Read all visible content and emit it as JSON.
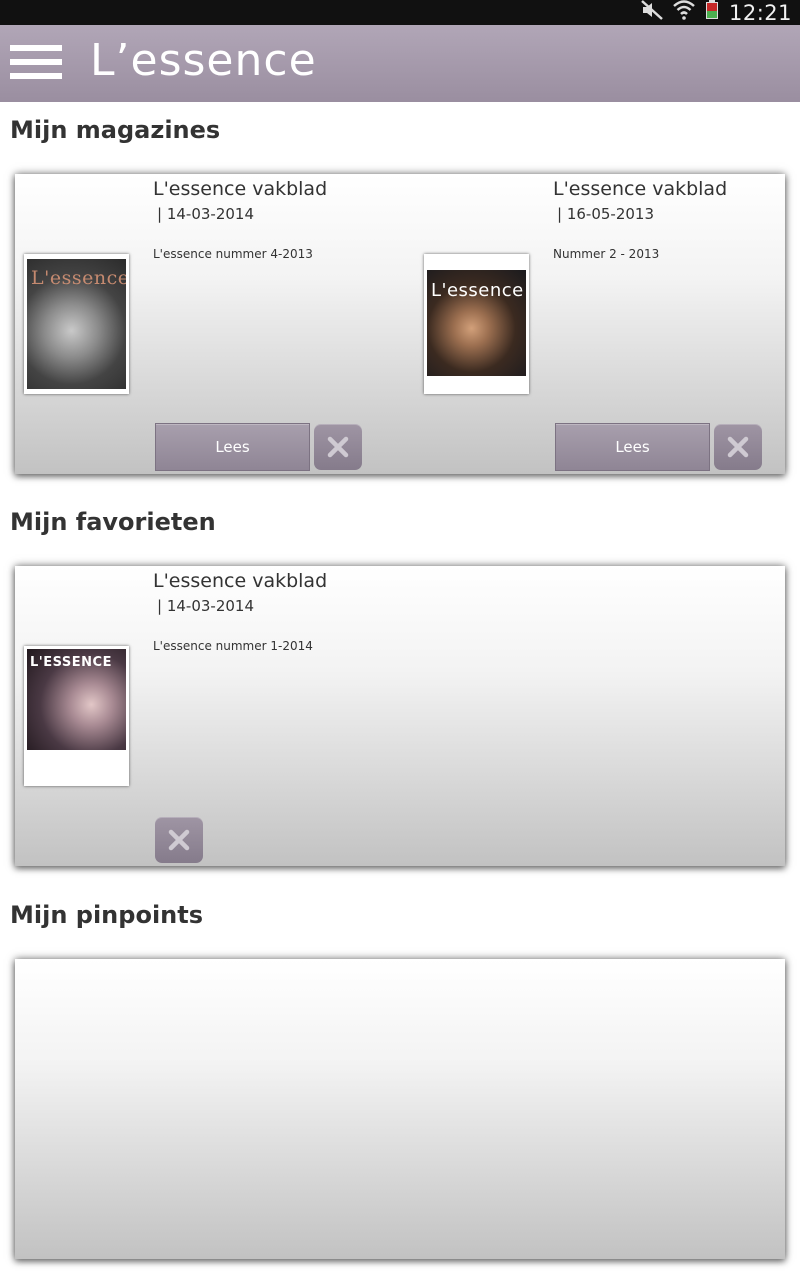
{
  "status_bar": {
    "time": "12:21",
    "icons": [
      "mute-icon",
      "wifi-icon",
      "battery-icon"
    ]
  },
  "app_bar": {
    "logo": "L’essence",
    "background": "#a89eae"
  },
  "sections": {
    "magazines": {
      "title": "Mijn magazines",
      "items": [
        {
          "title": "L'essence vakblad",
          "date": "| 14-03-2014",
          "description": "L'essence nummer 4-2013",
          "cover_logo": "L'essence",
          "read_label": "Lees"
        },
        {
          "title": "L'essence vakblad",
          "date": "| 16-05-2013",
          "description": "Nummer 2 - 2013",
          "cover_logo": "L'essence",
          "read_label": "Lees"
        }
      ]
    },
    "favorites": {
      "title": "Mijn favorieten",
      "items": [
        {
          "title": "L'essence vakblad",
          "date": "| 14-03-2014",
          "description": "L'essence nummer 1-2014",
          "cover_logo": "L'ESSENCE"
        }
      ]
    },
    "pinpoints": {
      "title": "Mijn pinpoints",
      "items": []
    }
  },
  "colors": {
    "accent": "#a89fad",
    "delete_button": "#928897"
  }
}
